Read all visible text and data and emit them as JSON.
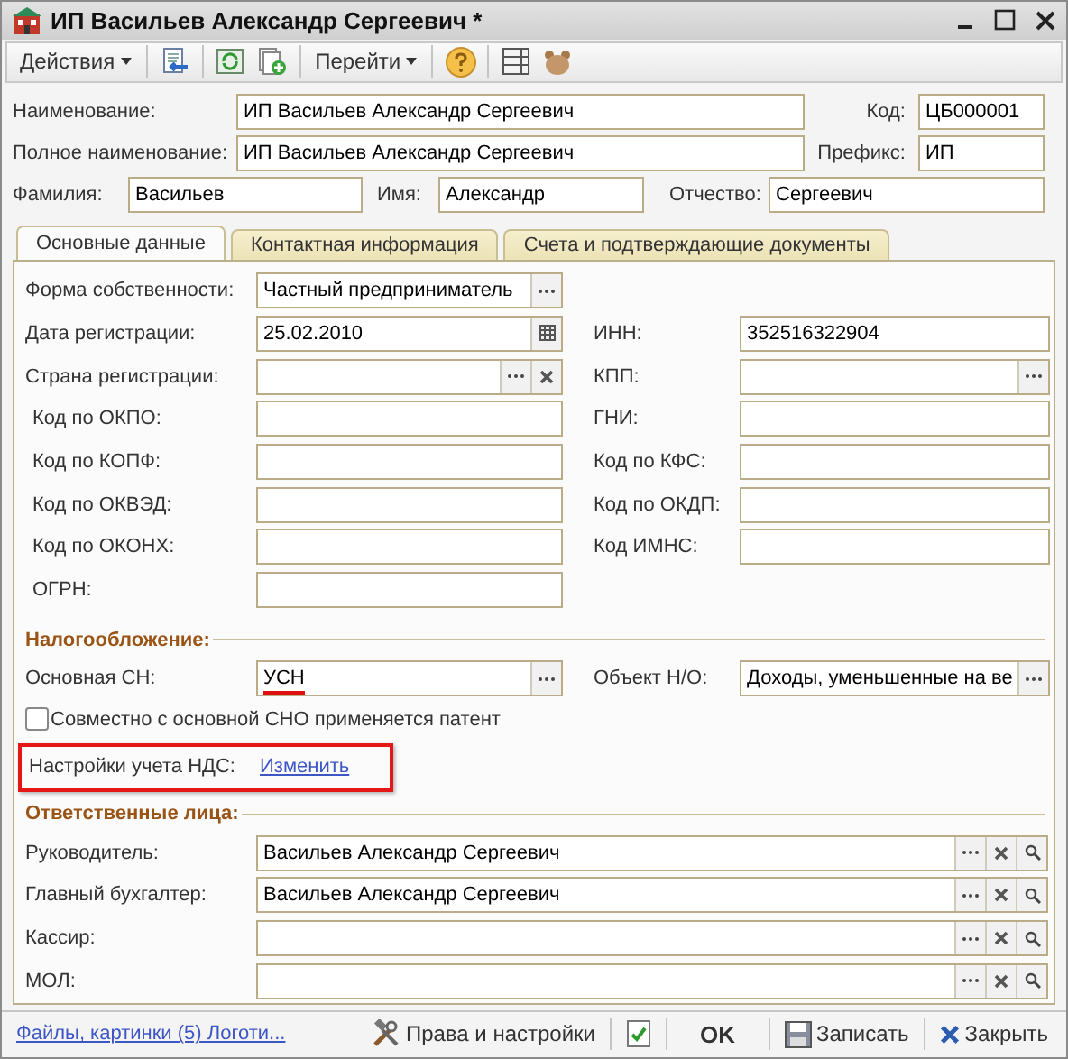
{
  "window": {
    "title": "ИП Васильев Александр Сергеевич *"
  },
  "toolbar": {
    "menus": [
      "Действия",
      "Перейти"
    ]
  },
  "header": [
    [
      {
        "label": "Наименование:",
        "value": "ИП Васильев Александр Сергеевич"
      },
      {
        "label": "Код:",
        "value": "ЦБ000001"
      }
    ],
    [
      {
        "label": "Полное наименование:",
        "value": "ИП Васильев Александр Сергеевич"
      },
      {
        "label": "Префикс:",
        "value": "ИП"
      }
    ],
    [
      {
        "label": "Фамилия:",
        "value": "Васильев"
      },
      {
        "label": "Имя:",
        "value": "Александр"
      },
      {
        "label": "Отчество:",
        "value": "Сергеевич"
      }
    ]
  ],
  "tabs": [
    {
      "label": "Основные данные",
      "selected": true
    },
    {
      "label": "Контактная информация",
      "selected": false
    },
    {
      "label": "Счета и подтверждающие документы",
      "selected": false
    }
  ],
  "main_rows": [
    {
      "left": {
        "label": "Форма собственности:",
        "value": "Частный предприниматель",
        "select_button": true
      }
    },
    {
      "left": {
        "label": "Дата регистрации:",
        "value": "25.02.2010",
        "calendar_button": true
      },
      "right": {
        "label": "ИНН:",
        "value": "352516322904"
      }
    },
    {
      "left": {
        "label": "Страна регистрации:",
        "select_button": true,
        "clear_button": true
      },
      "right": {
        "label": "КПП:",
        "select_button": true
      }
    },
    {
      "left": {
        "label": "Код по ОКПО:"
      },
      "right": {
        "label": "ГНИ:"
      }
    },
    {
      "left": {
        "label": "Код по КОПФ:"
      },
      "right": {
        "label": "Код по КФС:"
      }
    },
    {
      "left": {
        "label": "Код по ОКВЭД:"
      },
      "right": {
        "label": "Код по ОКДП:"
      }
    },
    {
      "left": {
        "label": "Код по ОКОНХ:"
      },
      "right": {
        "label": "Код ИМНС:"
      }
    },
    {
      "left": {
        "label": "ОГРН:"
      }
    }
  ],
  "taxation": {
    "title": "Налогообложение:",
    "main_sn": {
      "label": "Основная СН:",
      "value": "УСН",
      "select_button": true,
      "underlined": true
    },
    "object": {
      "label": "Объект Н/О:",
      "value": "Доходы, уменьшенные на ве",
      "select_button": true
    },
    "patent": {
      "label": "Совместно с основной СНО применяется патент",
      "checked": false
    },
    "vat": {
      "label": "Настройки учета НДС:",
      "link": "Изменить",
      "highlighted": true
    }
  },
  "responsible": {
    "title": "Ответственные лица:",
    "rows": [
      {
        "label": "Руководитель:",
        "value": "Васильев Александр Сергеевич",
        "select_button": true,
        "clear_button": true,
        "search_button": true
      },
      {
        "label": "Главный бухгалтер:",
        "value": "Васильев Александр Сергеевич",
        "select_button": true,
        "clear_button": true,
        "search_button": true
      },
      {
        "label": "Кассир:",
        "select_button": true,
        "clear_button": true,
        "search_button": true
      },
      {
        "label": "МОЛ:",
        "select_button": true,
        "clear_button": true,
        "search_button": true
      }
    ]
  },
  "footer": {
    "link": "Файлы, картинки (5) Логоти...",
    "buttons": [
      {
        "kind": "rights",
        "label": "Права и настройки"
      },
      {
        "kind": "check"
      },
      {
        "kind": "ok",
        "label": "OK"
      },
      {
        "kind": "save",
        "label": "Записать"
      },
      {
        "kind": "close",
        "label": "Закрыть"
      }
    ]
  }
}
